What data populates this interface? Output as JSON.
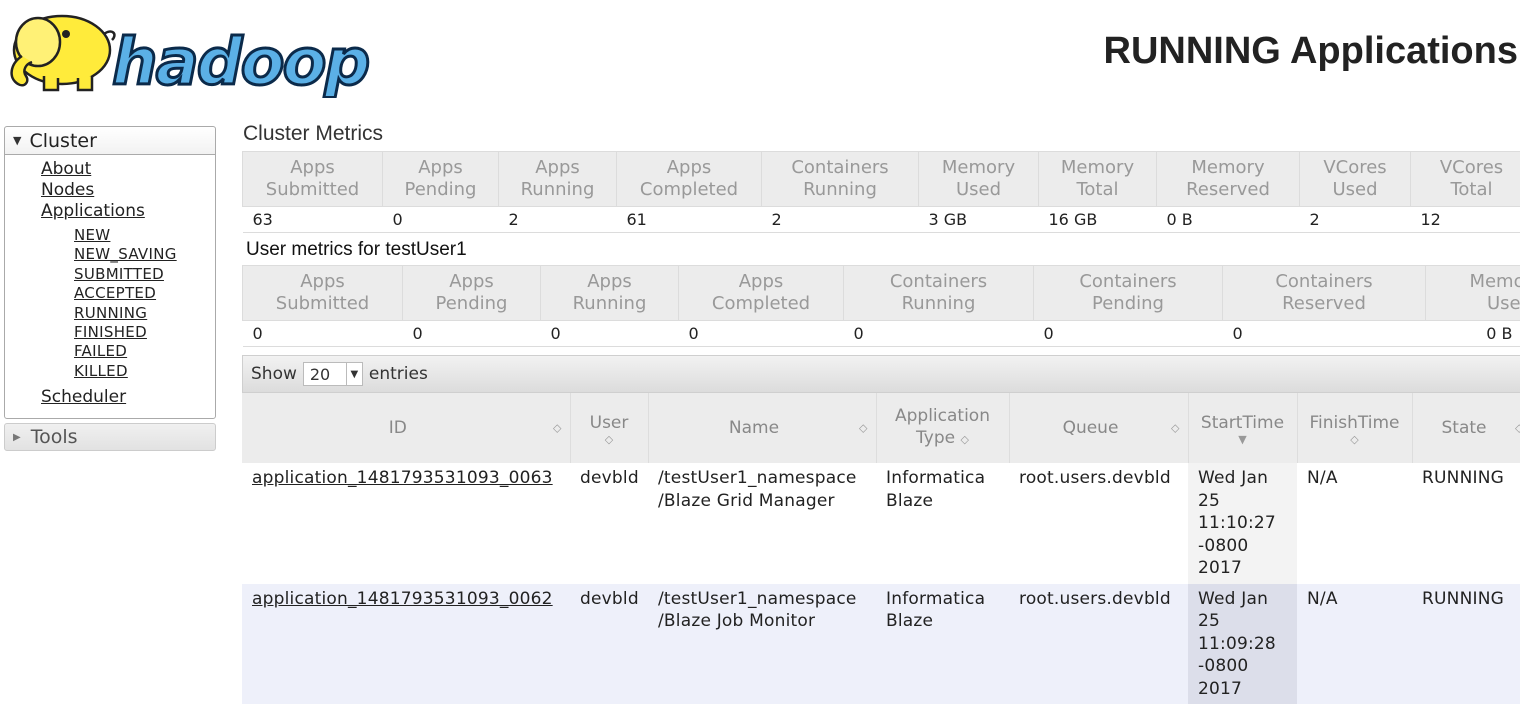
{
  "header": {
    "logo_text": "hadoop",
    "title": "RUNNING Applications"
  },
  "sidebar": {
    "cluster": {
      "label": "Cluster",
      "links": [
        "About",
        "Nodes",
        "Applications"
      ],
      "app_states": [
        "NEW",
        "NEW_SAVING",
        "SUBMITTED",
        "ACCEPTED",
        "RUNNING",
        "FINISHED",
        "FAILED",
        "KILLED"
      ],
      "scheduler": "Scheduler"
    },
    "tools": {
      "label": "Tools"
    }
  },
  "cluster_metrics": {
    "title": "Cluster Metrics",
    "headers": [
      [
        "Apps",
        "Submitted"
      ],
      [
        "Apps",
        "Pending"
      ],
      [
        "Apps",
        "Running"
      ],
      [
        "Apps",
        "Completed"
      ],
      [
        "Containers",
        "Running"
      ],
      [
        "Memory",
        "Used"
      ],
      [
        "Memory",
        "Total"
      ],
      [
        "Memory",
        "Reserved"
      ],
      [
        "VCores",
        "Used"
      ],
      [
        "VCores",
        "Total"
      ]
    ],
    "values": [
      "63",
      "0",
      "2",
      "61",
      "2",
      "3 GB",
      "16 GB",
      "0 B",
      "2",
      "12"
    ]
  },
  "user_metrics": {
    "title": "User metrics for testUser1",
    "headers": [
      [
        "Apps",
        "Submitted"
      ],
      [
        "Apps",
        "Pending"
      ],
      [
        "Apps",
        "Running"
      ],
      [
        "Apps",
        "Completed"
      ],
      [
        "Containers",
        "Running"
      ],
      [
        "Containers",
        "Pending"
      ],
      [
        "Containers",
        "Reserved"
      ],
      [
        "Memor",
        "Used"
      ]
    ],
    "values": [
      "0",
      "0",
      "0",
      "0",
      "0",
      "0",
      "0",
      "0 B"
    ]
  },
  "entries": {
    "show_label": "Show",
    "count": "20",
    "entries_label": "entries"
  },
  "apps_table": {
    "headers": {
      "id": "ID",
      "user": "User",
      "name": "Name",
      "app_type_1": "Application",
      "app_type_2": "Type",
      "queue": "Queue",
      "start_time": "StartTime",
      "finish_time": "FinishTime",
      "state": "State"
    },
    "rows": [
      {
        "id": "application_1481793531093_0063",
        "user": "devbld",
        "name_1": "/testUser1_namespace",
        "name_2": "/Blaze Grid Manager",
        "type_1": "Informatica",
        "type_2": "Blaze",
        "queue": "root.users.devbld",
        "start": [
          "Wed Jan",
          "25",
          "11:10:27",
          "-0800",
          "2017"
        ],
        "finish": "N/A",
        "state": "RUNNING"
      },
      {
        "id": "application_1481793531093_0062",
        "user": "devbld",
        "name_1": "/testUser1_namespace",
        "name_2": "/Blaze Job Monitor",
        "type_1": "Informatica",
        "type_2": "Blaze",
        "queue": "root.users.devbld",
        "start": [
          "Wed Jan",
          "25",
          "11:09:28",
          "-0800",
          "2017"
        ],
        "finish": "N/A",
        "state": "RUNNING"
      }
    ]
  }
}
